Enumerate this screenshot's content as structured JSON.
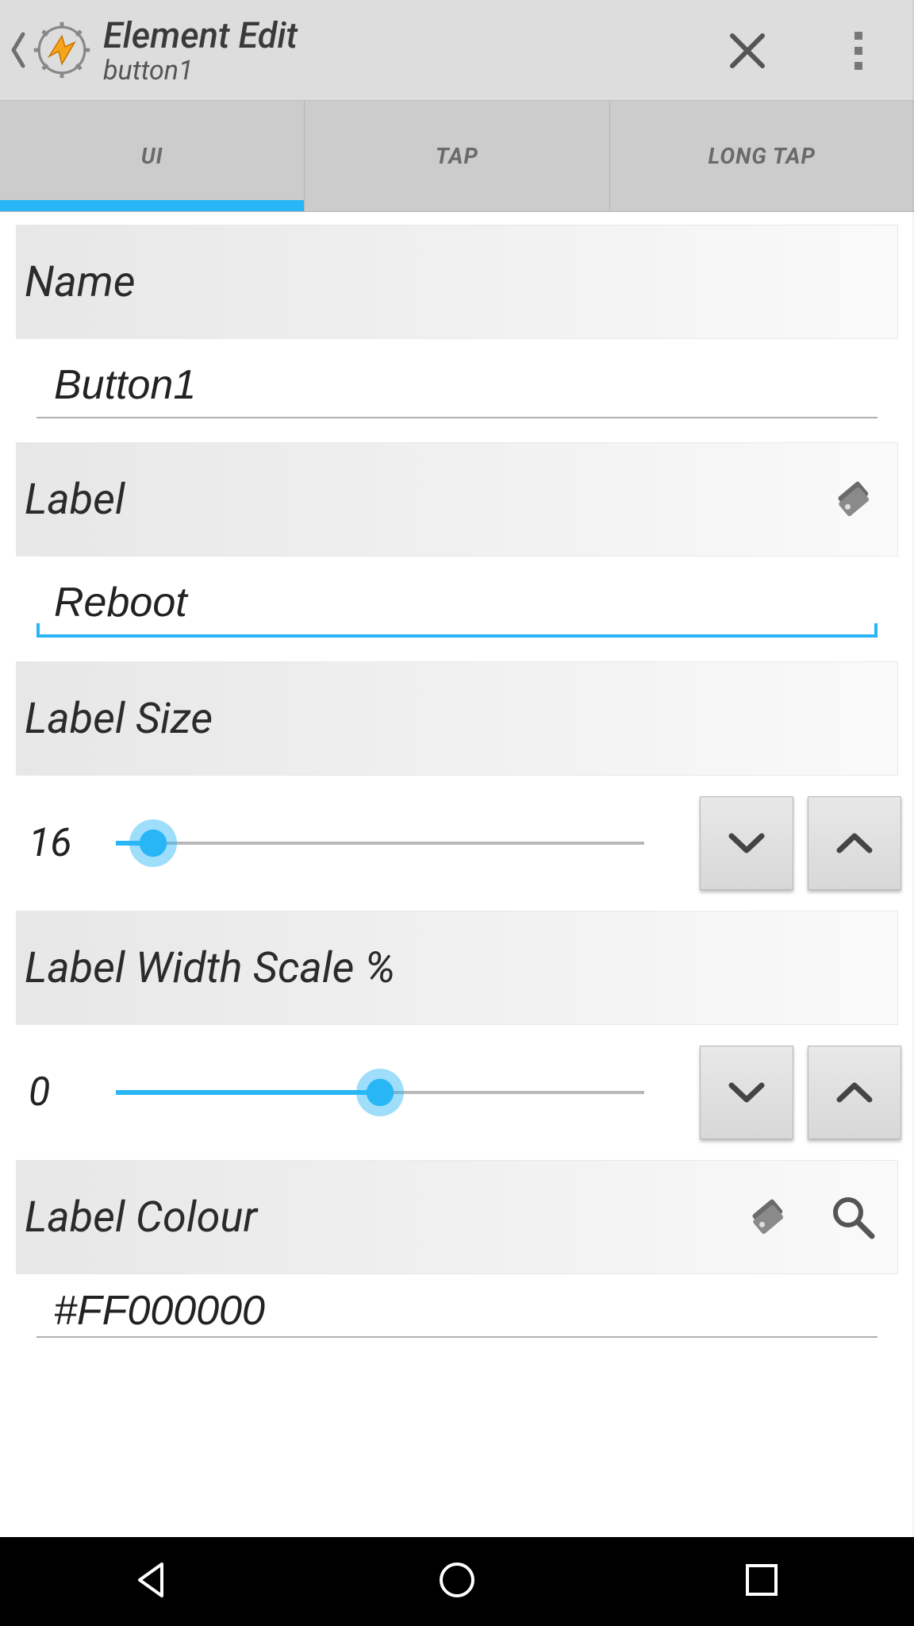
{
  "header": {
    "title": "Element Edit",
    "subtitle": "button1"
  },
  "tabs": {
    "items": [
      {
        "label": "UI",
        "active": true
      },
      {
        "label": "TAP",
        "active": false
      },
      {
        "label": "LONG TAP",
        "active": false
      }
    ]
  },
  "sections": {
    "name": {
      "title": "Name",
      "value": "Button1"
    },
    "label": {
      "title": "Label",
      "value": "Reboot"
    },
    "label_size": {
      "title": "Label Size",
      "value": 16,
      "slider_percent": 7
    },
    "label_width": {
      "title": "Label Width Scale %",
      "value": 0,
      "slider_percent": 50
    },
    "label_colour": {
      "title": "Label Colour",
      "value": "#FF000000"
    }
  },
  "icons": {
    "close": "close-icon",
    "menu": "overflow-menu-icon",
    "tag": "tag-icon",
    "search": "search-icon",
    "down": "chevron-down-icon",
    "up": "chevron-up-icon",
    "back": "back-icon",
    "home": "home-icon",
    "recents": "recents-icon"
  },
  "colors": {
    "accent": "#29b6f6",
    "header_bg": "#dddddd",
    "tab_bg": "#cccccc"
  }
}
